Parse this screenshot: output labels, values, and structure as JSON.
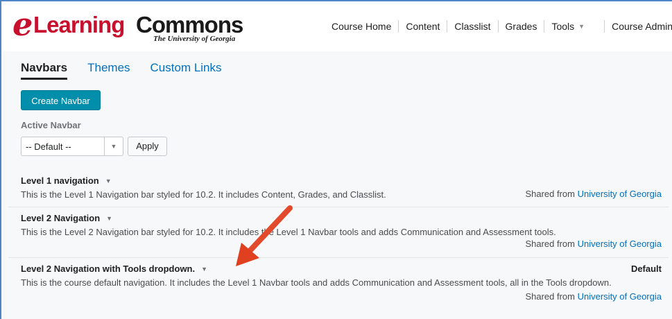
{
  "header": {
    "logo": {
      "e": "e",
      "learning": "Learning",
      "commons": "Commons",
      "subtitle": "The University of Georgia"
    },
    "nav": [
      {
        "label": "Course Home"
      },
      {
        "label": "Content"
      },
      {
        "label": "Classlist"
      },
      {
        "label": "Grades"
      },
      {
        "label": "Tools"
      },
      {
        "label": "Course Admin"
      }
    ]
  },
  "tabs": [
    {
      "label": "Navbars",
      "active": true
    },
    {
      "label": "Themes",
      "active": false
    },
    {
      "label": "Custom Links",
      "active": false
    }
  ],
  "create_button": "Create Navbar",
  "active_navbar": {
    "label": "Active Navbar",
    "selected": "-- Default --",
    "apply_label": "Apply"
  },
  "navbars": [
    {
      "title": "Level 1 navigation",
      "description": "This is the Level 1 Navigation bar styled for 10.2. It includes Content, Grades, and Classlist.",
      "shared_prefix": "Shared from",
      "shared_org": "University of Georgia"
    },
    {
      "title": "Level 2 Navigation",
      "description": "This is the Level 2 Navigation bar styled for 10.2. It includes the Level 1 Navbar tools and adds Communication and Assessment tools.",
      "shared_prefix": "Shared from",
      "shared_org": "University of Georgia"
    },
    {
      "title": "Level 2 Navigation with Tools dropdown.",
      "badge": "Default",
      "description": "This is the course default navigation.  It includes the Level 1 Navbar tools and adds Communication and Assessment tools, all in the Tools dropdown.",
      "shared_prefix": "Shared from",
      "shared_org": "University of Georgia"
    }
  ],
  "colors": {
    "brand_red": "#c8102e",
    "link_blue": "#006fbf",
    "primary_button": "#008eab",
    "annotation_arrow": "#e8432a"
  }
}
